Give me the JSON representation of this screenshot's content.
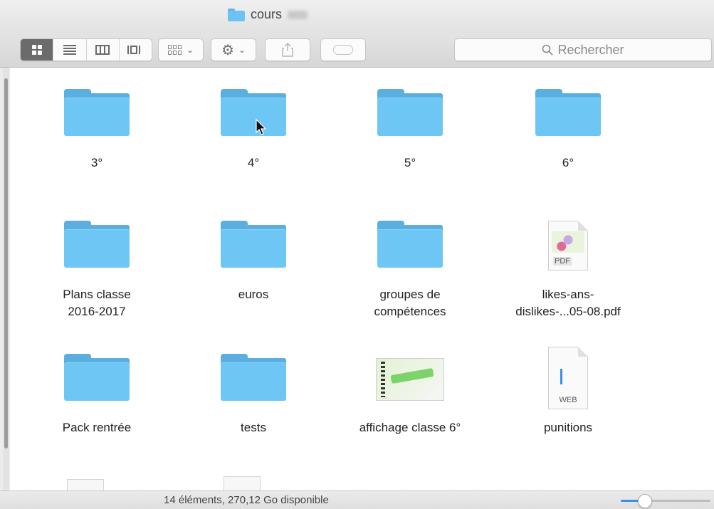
{
  "window": {
    "title": "cours"
  },
  "toolbar": {
    "views": [
      "icon",
      "list",
      "column",
      "cover-flow"
    ],
    "active_view": "icon",
    "arrange_icon": "arrange-icon",
    "action_icon": "gear-icon",
    "share_icon": "share-icon",
    "tag_icon": "tag-icon",
    "search_placeholder": "Rechercher"
  },
  "items": [
    {
      "label_lines": [
        "3°"
      ],
      "kind": "folder"
    },
    {
      "label_lines": [
        "4°"
      ],
      "kind": "folder"
    },
    {
      "label_lines": [
        "5°"
      ],
      "kind": "folder"
    },
    {
      "label_lines": [
        "6°"
      ],
      "kind": "folder"
    },
    {
      "label_lines": [
        "Plans classe",
        "2016-2017"
      ],
      "kind": "folder"
    },
    {
      "label_lines": [
        "euros"
      ],
      "kind": "folder"
    },
    {
      "label_lines": [
        "groupes de",
        "compétences"
      ],
      "kind": "folder"
    },
    {
      "label_lines": [
        "likes-ans-",
        "dislikes-...05-08.pdf"
      ],
      "kind": "pdf",
      "badge": "PDF"
    },
    {
      "label_lines": [
        "Pack rentrée"
      ],
      "kind": "folder"
    },
    {
      "label_lines": [
        "tests"
      ],
      "kind": "folder"
    },
    {
      "label_lines": [
        "affichage classe 6°"
      ],
      "kind": "image"
    },
    {
      "label_lines": [
        "punitions"
      ],
      "kind": "web",
      "badge": "WEB"
    }
  ],
  "status": {
    "text": "14 éléments, 270,12 Go disponible"
  },
  "zoom": {
    "level": 0.2
  },
  "colors": {
    "folder": "#6ec6f4",
    "folder_tab": "#5aaee0",
    "active_view": "#6b6b6b",
    "slider": "#3a8ff0"
  }
}
